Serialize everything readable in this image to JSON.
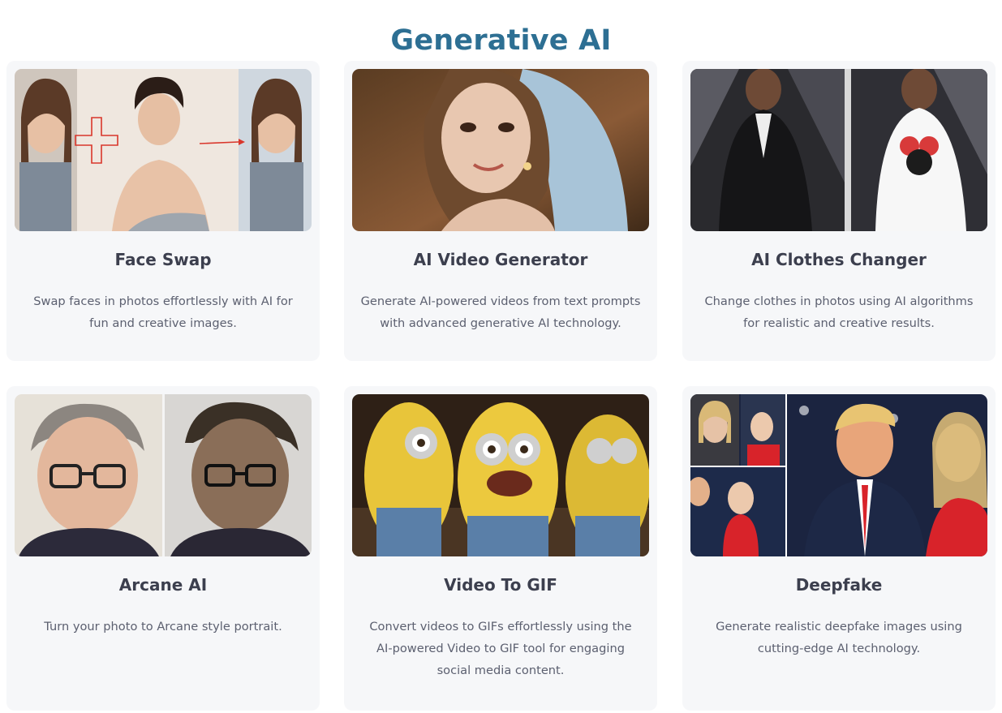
{
  "page": {
    "title": "Generative AI"
  },
  "theme": {
    "title_color": "#2d6f93",
    "card_bg": "#f6f7f9",
    "card_title_color": "#3c3f4e",
    "card_text_color": "#5c6070"
  },
  "cards": [
    {
      "title": "Face Swap",
      "description": "Swap faces in photos effortlessly with AI for fun and creative images.",
      "image_icon": "face-swap-image"
    },
    {
      "title": "AI Video Generator",
      "description": "Generate AI-powered videos from text prompts with advanced generative AI technology.",
      "image_icon": "ai-video-image"
    },
    {
      "title": "AI Clothes Changer",
      "description": "Change clothes in photos using AI algorithms for realistic and creative results.",
      "image_icon": "clothes-changer-image"
    },
    {
      "title": "Arcane AI",
      "description": "Turn your photo to Arcane style portrait.",
      "image_icon": "arcane-image"
    },
    {
      "title": "Video To GIF",
      "description": "Convert videos to GIFs effortlessly using the AI-powered Video to GIF tool for engaging social media content.",
      "image_icon": "video-to-gif-image"
    },
    {
      "title": "Deepfake",
      "description": "Generate realistic deepfake images using cutting-edge AI technology.",
      "image_icon": "deepfake-image"
    }
  ]
}
